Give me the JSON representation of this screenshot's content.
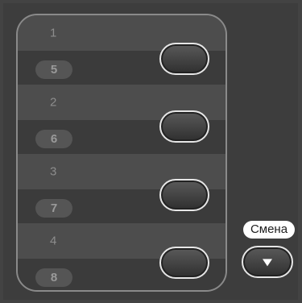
{
  "speed_dial_panel": {
    "rows": [
      {
        "top_number": "1",
        "bottom_number": "5"
      },
      {
        "top_number": "2",
        "bottom_number": "6"
      },
      {
        "top_number": "3",
        "bottom_number": "7"
      },
      {
        "top_number": "4",
        "bottom_number": "8"
      }
    ]
  },
  "shift": {
    "label": "Смена",
    "icon": "down-arrow-icon"
  }
}
